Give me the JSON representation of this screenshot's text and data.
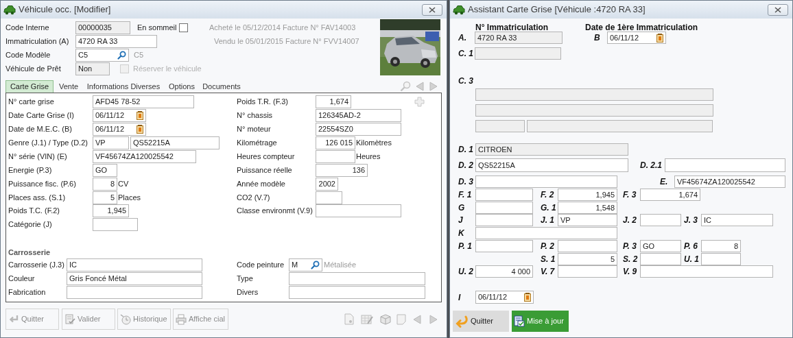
{
  "vehicle_window": {
    "title": "Véhicule occ. [Modifier]",
    "header_fields": [
      {
        "label": "Code Interne",
        "value": "00000035",
        "kind": "readonly"
      },
      {
        "label": "Immatriculation (A)",
        "value": "4720 RA 33",
        "kind": "text"
      },
      {
        "label": "Code Modèle",
        "value": "C5",
        "kind": "lookup",
        "description": "C5"
      },
      {
        "label": "Véhicule de Prêt",
        "value": "Non",
        "kind": "readonly"
      }
    ],
    "sleep_checkbox": {
      "label": "En sommeil",
      "checked": false,
      "disabled": false
    },
    "reserve_checkbox": {
      "label": "Réserver le véhicule",
      "checked": false,
      "disabled": true
    },
    "notes": [
      "Acheté le 05/12/2014 Facture N° FAV14003",
      "Vendu le 05/01/2015 Facture N° FVV14007"
    ],
    "tabs": [
      {
        "label": "Carte Grise",
        "selected": true
      },
      {
        "label": "Vente",
        "selected": false
      },
      {
        "label": "Informations Diverses",
        "selected": false
      },
      {
        "label": "Options",
        "selected": false
      },
      {
        "label": "Documents",
        "selected": false
      }
    ],
    "left_fields": [
      {
        "label": "N° carte grise",
        "value": "AFD45 78-52",
        "kind": "text"
      },
      {
        "label": "Date Carte Grise (I)",
        "value": "06/11/12",
        "kind": "date"
      },
      {
        "label": "Date de M.E.C. (B)",
        "value": "06/11/12",
        "kind": "date"
      },
      {
        "label": "Genre (J.1) / Type (D.2)",
        "value": "VP",
        "kind": "text"
      },
      {
        "value": "QS52215A",
        "kind": "text"
      },
      {
        "label": "N° série (VIN) (E)",
        "value": "VF45674ZA120025542",
        "kind": "text"
      },
      {
        "label": "Energie (P.3)",
        "value": "GO",
        "kind": "text"
      },
      {
        "label": "Puissance fisc. (P.6)",
        "value": "8",
        "kind": "number",
        "unit": "CV"
      },
      {
        "label": "Places ass. (S.1)",
        "value": "5",
        "kind": "number",
        "unit": "Places"
      },
      {
        "label": "Poids T.C. (F.2)",
        "value": "1,945",
        "kind": "number"
      },
      {
        "label": "Catégorie (J)",
        "kind": "text"
      }
    ],
    "right_fields": [
      {
        "label": "Poids T.R. (F.3)",
        "value": "1,674",
        "kind": "number"
      },
      {
        "label": "N° chassis",
        "value": "126345AD-2",
        "kind": "text"
      },
      {
        "label": "N° moteur",
        "value": "22554SZ0",
        "kind": "text"
      },
      {
        "label": "Kilométrage",
        "value": "126 015",
        "kind": "number",
        "unit": "Kilomètres"
      },
      {
        "label": "Heures compteur",
        "kind": "number",
        "unit": "Heures"
      },
      {
        "label": "Puissance réelle",
        "value": "136",
        "kind": "number"
      },
      {
        "label": "Année modèle",
        "value": "2002",
        "kind": "number"
      },
      {
        "label": "CO2 (V.7)",
        "kind": "text"
      },
      {
        "label": "Classe environmt (V.9)",
        "kind": "text"
      }
    ],
    "section_title": "Carrosserie",
    "body_left_fields": [
      {
        "label": "Carrosserie (J.3)",
        "value": "IC",
        "kind": "text"
      },
      {
        "label": "Couleur",
        "value": "Gris Foncé Métal",
        "kind": "text"
      },
      {
        "label": "Fabrication",
        "kind": "text"
      }
    ],
    "body_right_fields": [
      {
        "label": "Code peinture",
        "value": "M",
        "kind": "lookup",
        "description": "Métalisée"
      },
      {
        "label": "Type",
        "kind": "text"
      },
      {
        "label": "Divers",
        "kind": "text"
      }
    ],
    "buttons": [
      {
        "label": "Quitter",
        "disabled": true
      },
      {
        "label": "Valider",
        "disabled": true
      },
      {
        "label": "Historique",
        "disabled": true
      },
      {
        "label": "Affiche cial",
        "disabled": true
      }
    ]
  },
  "assistant_window": {
    "title": "Assistant Carte Grise [Véhicule :4720 RA 33]",
    "headings": [
      "N° Immatriculation",
      "Date de 1ère Immatriculation"
    ],
    "fields": [
      {
        "label": "A.",
        "value": "4720 RA 33",
        "kind": "readonly"
      },
      {
        "label": "B",
        "value": "06/11/12",
        "kind": "date"
      },
      {
        "label": "C. 1",
        "kind": "readonly"
      },
      {
        "label": "C. 3",
        "kind": "label"
      },
      {
        "kind": "readonly"
      },
      {
        "kind": "readonly"
      },
      {
        "kind": "readonly"
      },
      {
        "kind": "readonly"
      },
      {
        "label": "D. 1",
        "value": "CITROEN",
        "kind": "readonly"
      },
      {
        "label": "D. 2",
        "value": "QS52215A",
        "kind": "text"
      },
      {
        "label": "D. 2.1",
        "kind": "text"
      },
      {
        "label": "D. 3",
        "kind": "text"
      },
      {
        "label": "E.",
        "value": "VF45674ZA120025542",
        "kind": "text"
      },
      {
        "label": "F. 1",
        "kind": "text"
      },
      {
        "label": "F. 2",
        "value": "1,945",
        "kind": "number"
      },
      {
        "label": "F. 3",
        "value": "1,674",
        "kind": "number"
      },
      {
        "label": "G",
        "kind": "text"
      },
      {
        "label": "G. 1",
        "value": "1,548",
        "kind": "number"
      },
      {
        "label": "J",
        "kind": "text"
      },
      {
        "label": "J. 1",
        "value": "VP",
        "kind": "text"
      },
      {
        "label": "J. 2",
        "kind": "text"
      },
      {
        "label": "J. 3",
        "value": "IC",
        "kind": "text"
      },
      {
        "label": "K",
        "kind": "text"
      },
      {
        "label": "P. 1",
        "kind": "text"
      },
      {
        "label": "P. 2",
        "kind": "text"
      },
      {
        "label": "P. 3",
        "value": "GO",
        "kind": "text"
      },
      {
        "label": "P. 6",
        "value": "8",
        "kind": "number"
      },
      {
        "label": "S. 1",
        "value": "5",
        "kind": "number"
      },
      {
        "label": "S. 2",
        "kind": "text"
      },
      {
        "label": "U. 1",
        "kind": "text"
      },
      {
        "label": "U. 2",
        "value": "4 000",
        "kind": "number"
      },
      {
        "label": "V. 7",
        "kind": "text"
      },
      {
        "label": "V. 9",
        "kind": "text"
      },
      {
        "label": "I",
        "value": "06/11/12",
        "kind": "date"
      }
    ],
    "buttons": [
      {
        "label": "Quitter",
        "kind": "secondary"
      },
      {
        "label": "Mise à jour",
        "kind": "primary"
      }
    ]
  }
}
